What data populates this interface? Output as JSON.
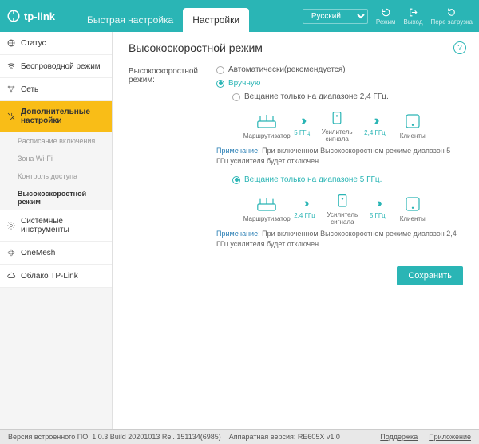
{
  "brand": "tp-link",
  "tabs": {
    "quick": "Быстрая настройка",
    "settings": "Настройки"
  },
  "lang": "Русский",
  "top_icons": {
    "mode": "Режим",
    "logout": "Выход",
    "reboot": "Пере загрузка"
  },
  "sidebar": {
    "status": "Статус",
    "wireless": "Беспроводной режим",
    "network": "Сеть",
    "advanced": "Дополнительные настройки",
    "subs": {
      "schedule": "Расписание включения",
      "zone": "Зона Wi-Fi",
      "access": "Контроль доступа",
      "highspeed": "Высокоскоростной режим"
    },
    "system": "Системные инструменты",
    "onemesh": "OneMesh",
    "cloud": "Облако TP-Link"
  },
  "page": {
    "title": "Высокоскоростной режим",
    "label": "Высокоскоростной режим:",
    "opt_auto": "Автоматически(рекомендуется)",
    "opt_manual": "Вручную",
    "opt_24": "Вещание только на диапазоне 2,4 ГГц.",
    "opt_5": "Вещание только на диапазоне 5 ГГц.",
    "diagram": {
      "router": "Маршрутизатор",
      "extender": "Усилитель сигнала",
      "clients": "Клиенты",
      "f5": "5 ГГц",
      "f24": "2,4 ГГц"
    },
    "note_label": "Примечание:",
    "note1": "При включенном Высокоскоростном режиме диапазон 5 ГГц усилителя будет отключен.",
    "note2": "При включенном Высокоскоростном режиме диапазон 2,4 ГГц усилителя будет отключен.",
    "save": "Сохранить"
  },
  "footer": {
    "fw_label": "Версия встроенного ПО:",
    "fw": "1.0.3 Build 20201013 Rel. 151134(6985)",
    "hw_label": "Аппаратная версия:",
    "hw": "RE605X v1.0",
    "support": "Поддержка",
    "app": "Приложение"
  }
}
